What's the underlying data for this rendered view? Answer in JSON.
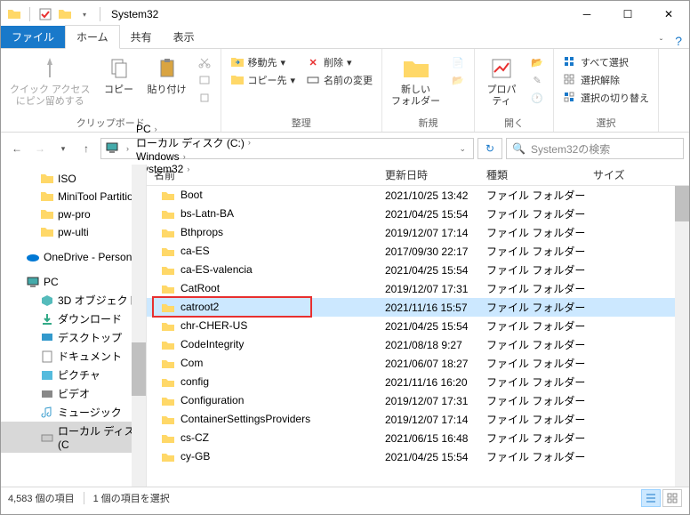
{
  "window": {
    "title": "System32"
  },
  "tabs": {
    "file": "ファイル",
    "home": "ホーム",
    "share": "共有",
    "view": "表示"
  },
  "ribbon": {
    "group_clipboard": "クリップボード",
    "group_organize": "整理",
    "group_new": "新規",
    "group_open": "開く",
    "group_select": "選択",
    "pin_quick": "クイック アクセス\nにピン留めする",
    "copy": "コピー",
    "paste": "貼り付け",
    "move_to": "移動先",
    "copy_to": "コピー先",
    "delete": "削除",
    "rename": "名前の変更",
    "new_folder": "新しい\nフォルダー",
    "properties": "プロパ\nティ",
    "select_all": "すべて選択",
    "select_none": "選択解除",
    "select_invert": "選択の切り替え"
  },
  "breadcrumbs": [
    "PC",
    "ローカル ディスク (C:)",
    "Windows",
    "System32"
  ],
  "search": {
    "placeholder": "System32の検索"
  },
  "columns": {
    "name": "名前",
    "date": "更新日時",
    "type": "種類",
    "size": "サイズ"
  },
  "col_widths": {
    "name": 260,
    "date": 114,
    "type": 120,
    "size": 80
  },
  "tree": [
    {
      "label": "ISO",
      "icon": "folder",
      "level": 1
    },
    {
      "label": "MiniTool Partitio",
      "icon": "folder",
      "level": 1
    },
    {
      "label": "pw-pro",
      "icon": "folder",
      "level": 1
    },
    {
      "label": "pw-ulti",
      "icon": "folder",
      "level": 1
    },
    {
      "label": "",
      "icon": "blank",
      "level": 1
    },
    {
      "label": "OneDrive - Person",
      "icon": "onedrive",
      "level": 0
    },
    {
      "label": "",
      "icon": "blank",
      "level": 0
    },
    {
      "label": "PC",
      "icon": "pc",
      "level": 0
    },
    {
      "label": "3D オブジェクト",
      "icon": "3d",
      "level": 1
    },
    {
      "label": "ダウンロード",
      "icon": "download",
      "level": 1
    },
    {
      "label": "デスクトップ",
      "icon": "desktop",
      "level": 1
    },
    {
      "label": "ドキュメント",
      "icon": "document",
      "level": 1
    },
    {
      "label": "ピクチャ",
      "icon": "picture",
      "level": 1
    },
    {
      "label": "ビデオ",
      "icon": "video",
      "level": 1
    },
    {
      "label": "ミュージック",
      "icon": "music",
      "level": 1
    },
    {
      "label": "ローカル ディスク (C",
      "icon": "hdd",
      "level": 1,
      "selected": true
    }
  ],
  "rows": [
    {
      "name": "Boot",
      "date": "2021/10/25 13:42",
      "type": "ファイル フォルダー"
    },
    {
      "name": "bs-Latn-BA",
      "date": "2021/04/25 15:54",
      "type": "ファイル フォルダー"
    },
    {
      "name": "Bthprops",
      "date": "2019/12/07 17:14",
      "type": "ファイル フォルダー"
    },
    {
      "name": "ca-ES",
      "date": "2017/09/30 22:17",
      "type": "ファイル フォルダー"
    },
    {
      "name": "ca-ES-valencia",
      "date": "2021/04/25 15:54",
      "type": "ファイル フォルダー"
    },
    {
      "name": "CatRoot",
      "date": "2019/12/07 17:31",
      "type": "ファイル フォルダー"
    },
    {
      "name": "catroot2",
      "date": "2021/11/16 15:57",
      "type": "ファイル フォルダー",
      "selected": true,
      "highlight": true
    },
    {
      "name": "chr-CHER-US",
      "date": "2021/04/25 15:54",
      "type": "ファイル フォルダー"
    },
    {
      "name": "CodeIntegrity",
      "date": "2021/08/18 9:27",
      "type": "ファイル フォルダー"
    },
    {
      "name": "Com",
      "date": "2021/06/07 18:27",
      "type": "ファイル フォルダー"
    },
    {
      "name": "config",
      "date": "2021/11/16 16:20",
      "type": "ファイル フォルダー"
    },
    {
      "name": "Configuration",
      "date": "2019/12/07 17:31",
      "type": "ファイル フォルダー"
    },
    {
      "name": "ContainerSettingsProviders",
      "date": "2019/12/07 17:14",
      "type": "ファイル フォルダー"
    },
    {
      "name": "cs-CZ",
      "date": "2021/06/15 16:48",
      "type": "ファイル フォルダー"
    },
    {
      "name": "cy-GB",
      "date": "2021/04/25 15:54",
      "type": "ファイル フォルダー"
    }
  ],
  "status": {
    "items": "4,583 個の項目",
    "selected": "1 個の項目を選択"
  }
}
